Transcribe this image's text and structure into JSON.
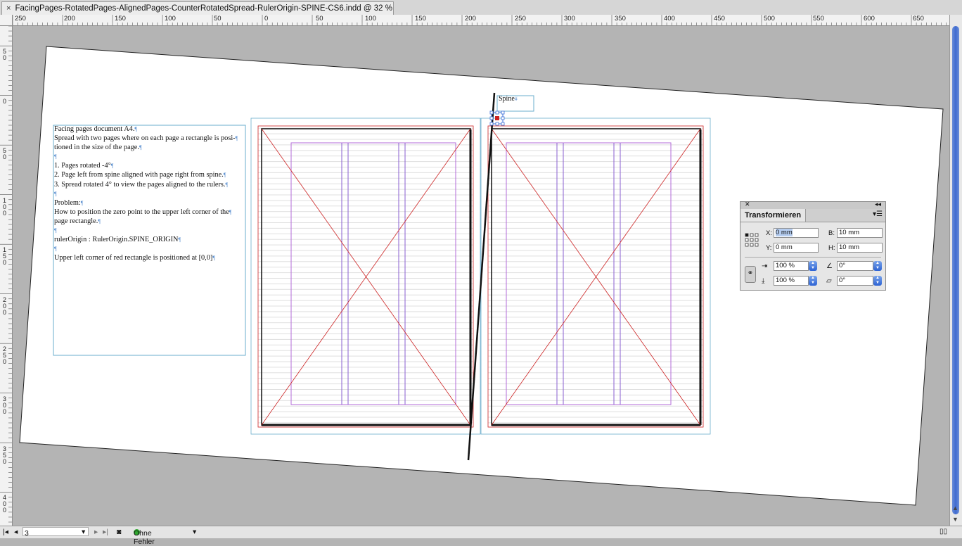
{
  "window": {
    "tab_close": "×",
    "tab_title": "FacingPages-RotatedPages-AlignedPages-CounterRotatedSpread-RulerOrigin-SPINE-CS6.indd @ 32 %"
  },
  "ruler": {
    "horizontal": [
      "250",
      "200",
      "150",
      "100",
      "50",
      "0",
      "50",
      "100",
      "150",
      "200",
      "250",
      "300",
      "350",
      "400",
      "450",
      "500",
      "550",
      "600",
      "650"
    ],
    "vertical": [
      "50",
      "0",
      "50",
      "100",
      "150",
      "200",
      "250",
      "300",
      "350",
      "400"
    ]
  },
  "document": {
    "text_lines": [
      "Facing pages document A4.",
      "Spread with two pages where on each page a rectangle is posi-",
      "tioned in the size of the page.",
      "",
      "1. Pages rotated -4°",
      "2. Page left from spine aligned with page right from spine.",
      "3. Spread rotated 4° to view the pages aligned to the rulers.",
      "",
      "Problem:",
      "How to position the zero point to the upper left corner of the",
      "page rectangle.",
      "",
      "rulerOrigin : RulerOrigin.SPINE_ORIGIN",
      "",
      "Upper left corner of red rectangle is positioned at [0,0]"
    ],
    "pilcrow": "¶",
    "spine_label": "Spine",
    "spine_mark": "#"
  },
  "transform_panel": {
    "title": "Transformieren",
    "x_label": "X:",
    "x_value": "0 mm",
    "y_label": "Y:",
    "y_value": "0 mm",
    "w_label": "B:",
    "w_value": "10 mm",
    "h_label": "H:",
    "h_value": "10 mm",
    "scale_x": "100 %",
    "scale_y": "100 %",
    "rotation": "0°",
    "shear": "0°"
  },
  "statusbar": {
    "page_number": "3",
    "preflight": "Ohne Fehler"
  },
  "colors": {
    "margin": "#b36bd8",
    "page_edge": "#cc2222",
    "bleed": "#6aaccc",
    "column": "#8a5fd0"
  }
}
